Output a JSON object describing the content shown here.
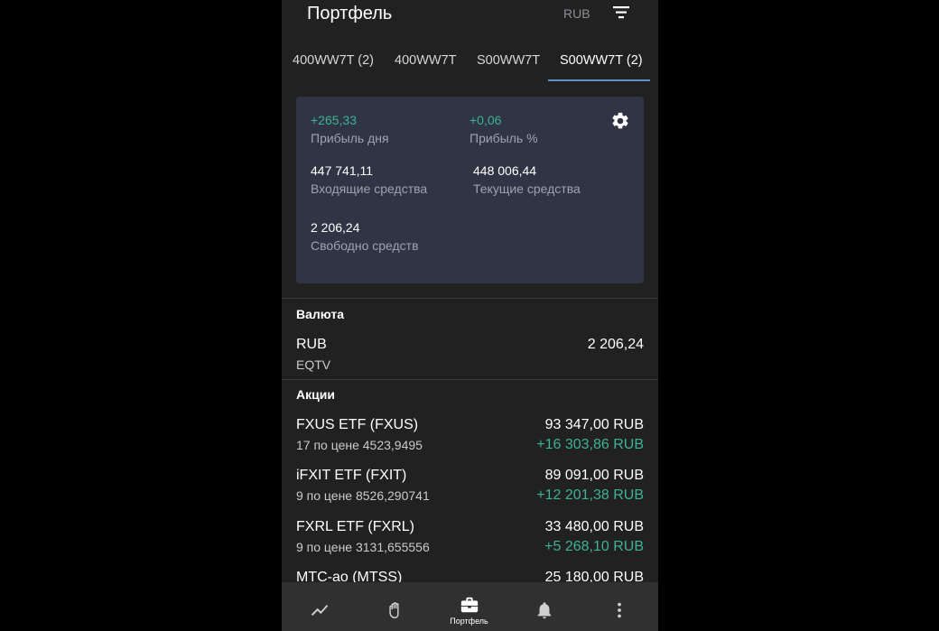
{
  "app_bar": {
    "title": "Портфель",
    "currency": "RUB",
    "filter_icon": "filter-icon"
  },
  "tabs": [
    {
      "label": "400WW7T (2)",
      "active": false
    },
    {
      "label": "400WW7T",
      "active": false
    },
    {
      "label": "S00WW7T",
      "active": false
    },
    {
      "label": "S00WW7T (2)",
      "active": true
    }
  ],
  "summary": {
    "day_profit_value": "+265,33",
    "day_profit_label": "Прибыль дня",
    "profit_pct_value": "+0,06",
    "profit_pct_label": "Прибыль %",
    "incoming_value": "447 741,11",
    "incoming_label": "Входящие средства",
    "current_value": "448 006,44",
    "current_label": "Текущие средства",
    "free_value": "2 206,24",
    "free_label": "Свободно средств",
    "settings_icon": "gear-icon"
  },
  "currency_section": {
    "title": "Валюта",
    "items": [
      {
        "name": "RUB",
        "sub": "EQTV",
        "amount": "2 206,24"
      }
    ]
  },
  "stocks_section": {
    "title": "Акции",
    "items": [
      {
        "name": "FXUS ETF (FXUS)",
        "sub": "17 по цене 4523,9495",
        "amount": "93 347,00 RUB",
        "profit": "+16 303,86 RUB"
      },
      {
        "name": "iFXIT ETF (FXIT)",
        "sub": "9 по цене 8526,290741",
        "amount": "89 091,00 RUB",
        "profit": "+12 201,38 RUB"
      },
      {
        "name": "FXRL ETF (FXRL)",
        "sub": "9 по цене 3131,655556",
        "amount": "33 480,00 RUB",
        "profit": "+5 268,10 RUB"
      },
      {
        "name": "МТС-ао (MTSS)",
        "sub": "",
        "amount": "25 180,00 RUB",
        "profit": ""
      }
    ]
  },
  "bottom_nav": [
    {
      "icon": "chart-line-icon",
      "label": ""
    },
    {
      "icon": "hand-icon",
      "label": ""
    },
    {
      "icon": "briefcase-icon",
      "label": "Портфель",
      "active": true
    },
    {
      "icon": "bell-icon",
      "label": ""
    },
    {
      "icon": "more-vertical-icon",
      "label": ""
    }
  ],
  "colors": {
    "background": "#212121",
    "card": "#303545",
    "positive": "#3db295",
    "tab_indicator": "#5f8fc9",
    "nav_bar": "#303030"
  }
}
